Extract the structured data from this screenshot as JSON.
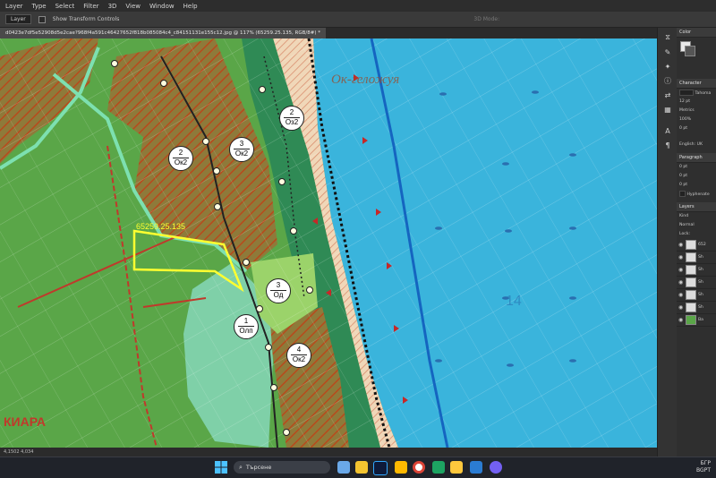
{
  "menubar": {
    "items": [
      "Layer",
      "Type",
      "Select",
      "Filter",
      "3D",
      "View",
      "Window",
      "Help"
    ]
  },
  "options": {
    "auto_select_value": "Layer",
    "show_transform_label": "Show Transform Controls",
    "mode_label": "3D Mode:"
  },
  "document": {
    "tab_title": "d0423e7df5e52908d5e2cae?968f4a591c46427652f818b085084c4_c84151131e155c12.jpg @ 117% (65259.25.135, RGB/8#) *"
  },
  "statusbar": {
    "text": "4,1502 4,034"
  },
  "map": {
    "parcel_label": "65259.25.135",
    "place_label": "КИАРА",
    "sea_label": "Ок-геложуя",
    "sea_number": "14",
    "zones": [
      {
        "num": "2",
        "code": "Ок2"
      },
      {
        "num": "3",
        "code": "Ок2"
      },
      {
        "num": "2",
        "code": "Оз2"
      },
      {
        "num": "3",
        "code": "Од"
      },
      {
        "num": "1",
        "code": "Олп"
      },
      {
        "num": "4",
        "code": "Ок2"
      }
    ],
    "colors": {
      "green": "#5aa648",
      "sea": "#3ab4dc",
      "hatch": "#b44a1e",
      "beach": "#e8c8a8",
      "outline": "#7de0b0",
      "highlight": "#ffff30"
    }
  },
  "panels": {
    "color_title": "Color",
    "character_title": "Character",
    "character_rows": [
      "Tahoma",
      "12 pt",
      "Metrics",
      "100%",
      "0 pt",
      "English: UK"
    ],
    "paragraph_title": "Paragraph",
    "paragraph_rows": [
      "0 pt",
      "0 pt",
      "0 pt",
      "Hyphenate"
    ],
    "layers_title": "Layers",
    "layers_kind": "Kind",
    "layers_mode": "Normal",
    "lock_label": "Lock:",
    "layer_names": [
      "652",
      "Sh",
      "Sh",
      "Sh",
      "Sh",
      "Sh",
      "Ba"
    ]
  },
  "taskbar": {
    "search_label": "Търсене",
    "lang": "БГР",
    "lang2": "BGPT"
  }
}
